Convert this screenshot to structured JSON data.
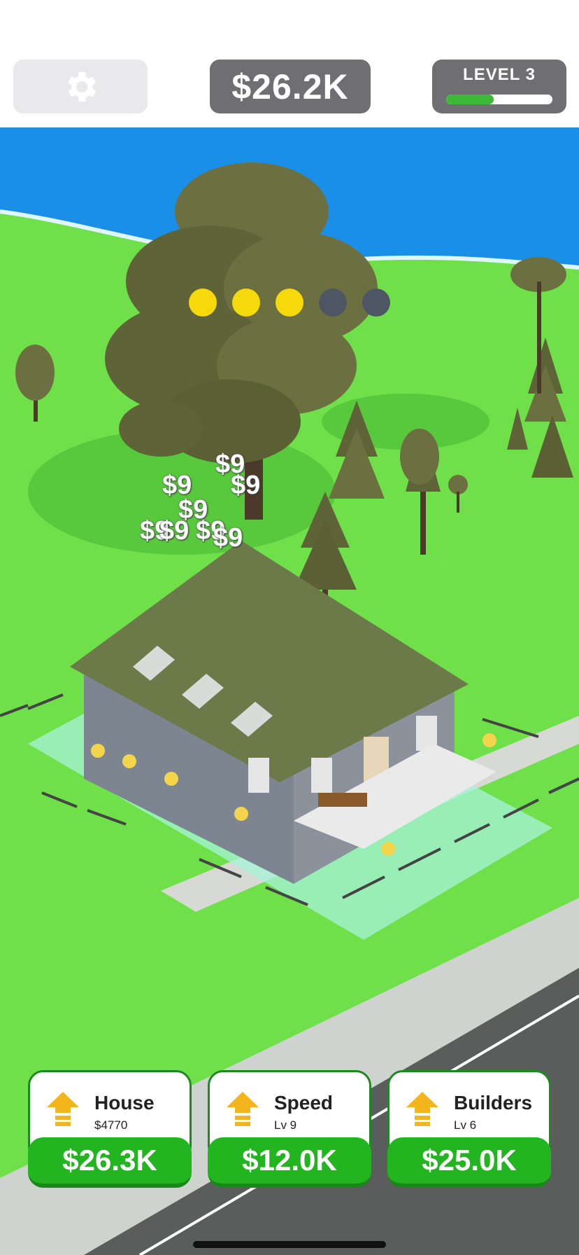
{
  "hud": {
    "settings_icon": "gear-icon",
    "money": "$26.2K",
    "level_label": "LEVEL 3",
    "level_progress": 0.45
  },
  "stage_progress": {
    "filled": 3,
    "total": 5,
    "filled_color": "#f5d90a",
    "empty_color": "#4e5563"
  },
  "floating_rewards": [
    "$9",
    "$9",
    "$9",
    "$9",
    "$9",
    "$9",
    "$9",
    "$9"
  ],
  "upgrades": [
    {
      "title": "House",
      "subtitle": "$4770",
      "price": "$26.3K",
      "icon": "upgrade-arrow-icon"
    },
    {
      "title": "Speed",
      "subtitle": "Lv 9",
      "price": "$12.0K",
      "icon": "upgrade-arrow-icon"
    },
    {
      "title": "Builders",
      "subtitle": "Lv 6",
      "price": "$25.0K",
      "icon": "upgrade-arrow-icon"
    }
  ],
  "colors": {
    "grass": "#6fe04a",
    "sea": "#1a8fe8",
    "button_green": "#22b51f",
    "hud_gray": "#6f6f73"
  }
}
